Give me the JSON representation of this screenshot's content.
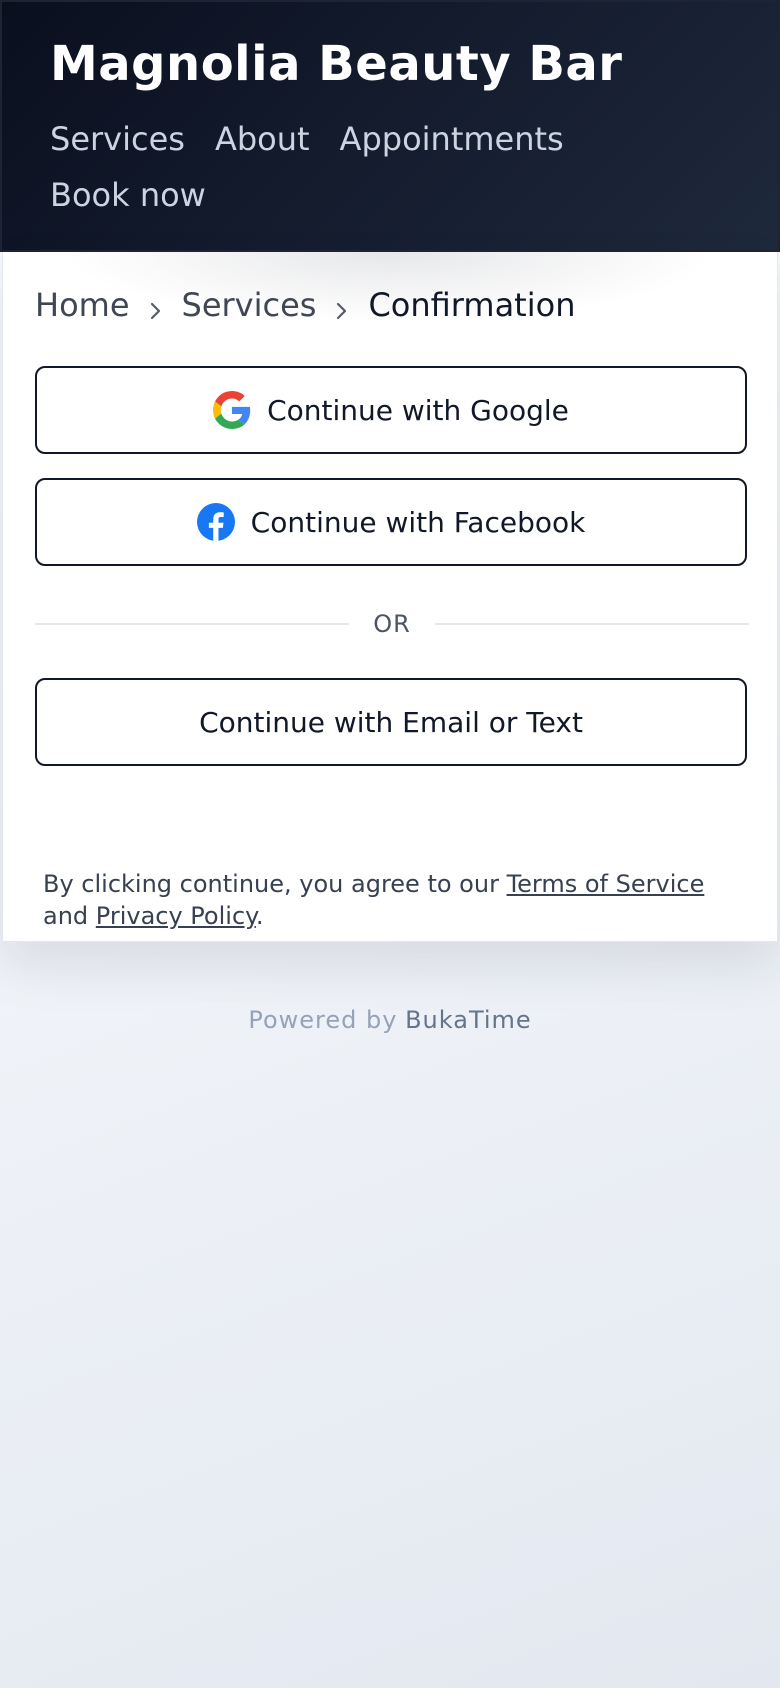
{
  "header": {
    "brand": "Magnolia Beauty Bar",
    "nav": [
      "Services",
      "About",
      "Appointments",
      "Book now"
    ]
  },
  "breadcrumb": {
    "home": "Home",
    "services": "Services",
    "current": "Confirmation"
  },
  "auth": {
    "google_label": "Continue with Google",
    "facebook_label": "Continue with Facebook",
    "divider": "OR",
    "email_label": "Continue with Email or Text"
  },
  "terms": {
    "prefix": "By clicking continue, you agree to our ",
    "tos": "Terms of Service",
    "middle": " and ",
    "privacy": "Privacy Policy",
    "suffix": "."
  },
  "footer": {
    "powered_by": "Powered by",
    "brand": "BukaTime"
  },
  "icons": {
    "google": "google-g-icon",
    "facebook": "facebook-icon",
    "separator": "chevron-right-icon"
  },
  "colors": {
    "header_bg": "#0f172a",
    "facebook_blue": "#1877f2",
    "google_blue": "#4285f4",
    "google_red": "#ea4335",
    "google_yellow": "#fbbc05",
    "google_green": "#34a853"
  }
}
